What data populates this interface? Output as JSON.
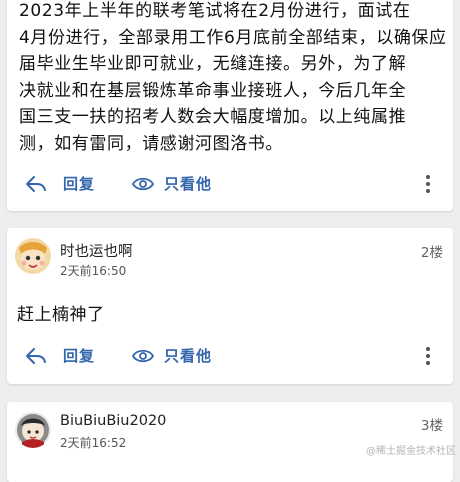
{
  "post": {
    "body_lines": [
      "2023年上半年的联考笔试将在2月份进行，面试在",
      "4月份进行，全部录用工作6月底前全部结束，以确保应",
      "届毕业生毕业即可就业，无缝连接。另外，为了解",
      "决就业和在基层锻炼革命事业接班人，今后几年全",
      "国三支一扶的招考人数会大幅度增加。以上纯属推",
      "测，如有雷同，请感谢河图洛书。"
    ]
  },
  "actions": {
    "reply_label": "回复",
    "view_only_label": "只看他"
  },
  "comments": [
    {
      "username": "时也运也啊",
      "time": "2天前16:50",
      "floor": "2楼",
      "text": "赶上楠神了"
    },
    {
      "username": "BiuBiuBiu2020",
      "time": "2天前16:52",
      "floor": "3楼"
    }
  ],
  "watermark": "@稀土掘金技术社区",
  "colors": {
    "action_blue": "#3366ac",
    "background": "#eeeeee",
    "card": "#ffffff"
  },
  "icons": {
    "reply": "reply-arrow-icon",
    "view_only": "eye-icon",
    "more": "more-vertical-icon"
  }
}
